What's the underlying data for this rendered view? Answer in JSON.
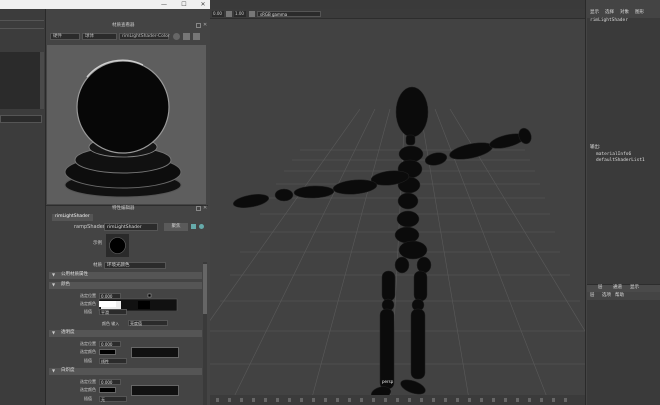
{
  "window": {
    "minimize": "—",
    "maximize": "☐",
    "close": "✕"
  },
  "swatch": {
    "title": "材质查看器",
    "renderer": "硬件",
    "mode": "球体",
    "shader_name": "rimLightShader-Color"
  },
  "attr": {
    "title": "特性编辑器",
    "tab": "rimLightShader",
    "type_label": "rampShader:",
    "type_value": "rimLightShader",
    "focus_button": "聚焦",
    "sample_label": "示例",
    "material_label": "材质",
    "material_value": "环境光颜色",
    "sections": {
      "s1": "公用材质属性",
      "s2": "颜色",
      "s3": "透明度",
      "s4": "白炽度"
    },
    "color": {
      "pos": "选定位置",
      "pos_value": "0.000",
      "col": "选定颜色",
      "interp": "插值",
      "interp_value": "平滑",
      "input_label": "颜色 输入",
      "input_value": "亮度值"
    },
    "trans": {
      "pos": "选定位置",
      "pos_value": "0.000",
      "col": "选定颜色",
      "interp": "插值",
      "interp_value": "线性"
    },
    "incan": {
      "pos": "选定位置",
      "pos_value": "0.000",
      "col": "选定颜色",
      "interp": "插值",
      "interp_value": "无"
    }
  },
  "viewport": {
    "val1": "0.00",
    "val2": "1.00",
    "colorspace": "sRGB gamma",
    "cam": "persp"
  },
  "right": {
    "menu": [
      "显示",
      "选择",
      "对象",
      "图形"
    ],
    "item1": "rimLightShader",
    "heading": "输出:",
    "out1": "materialInfo6",
    "out2": "defaultShaderList1",
    "tabs2": [
      "层",
      "通道",
      "显示"
    ],
    "menu2": [
      "层",
      "选项",
      "帮助"
    ]
  },
  "colors": {
    "panel": "#444444",
    "field": "#2b2b2b",
    "figure": "#0b0b0b"
  }
}
